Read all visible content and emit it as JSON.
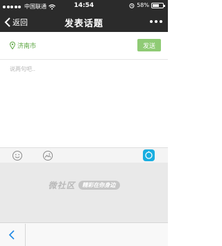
{
  "status_bar": {
    "carrier": "中国联通",
    "time": "14:54",
    "battery": "58%",
    "battery_level": 0.58
  },
  "nav": {
    "back_label": "返回",
    "title": "发表话题"
  },
  "location": {
    "city": "济南市",
    "send_label": "发送"
  },
  "editor": {
    "placeholder": "说两句吧.."
  },
  "brand": {
    "name": "微社区",
    "slogan": "精彩在你身边"
  },
  "colors": {
    "topbar": "#2b2b2b",
    "location_green": "#5aa53f",
    "send_button": "#8fcb75",
    "camera_accent": "#19aee0"
  }
}
